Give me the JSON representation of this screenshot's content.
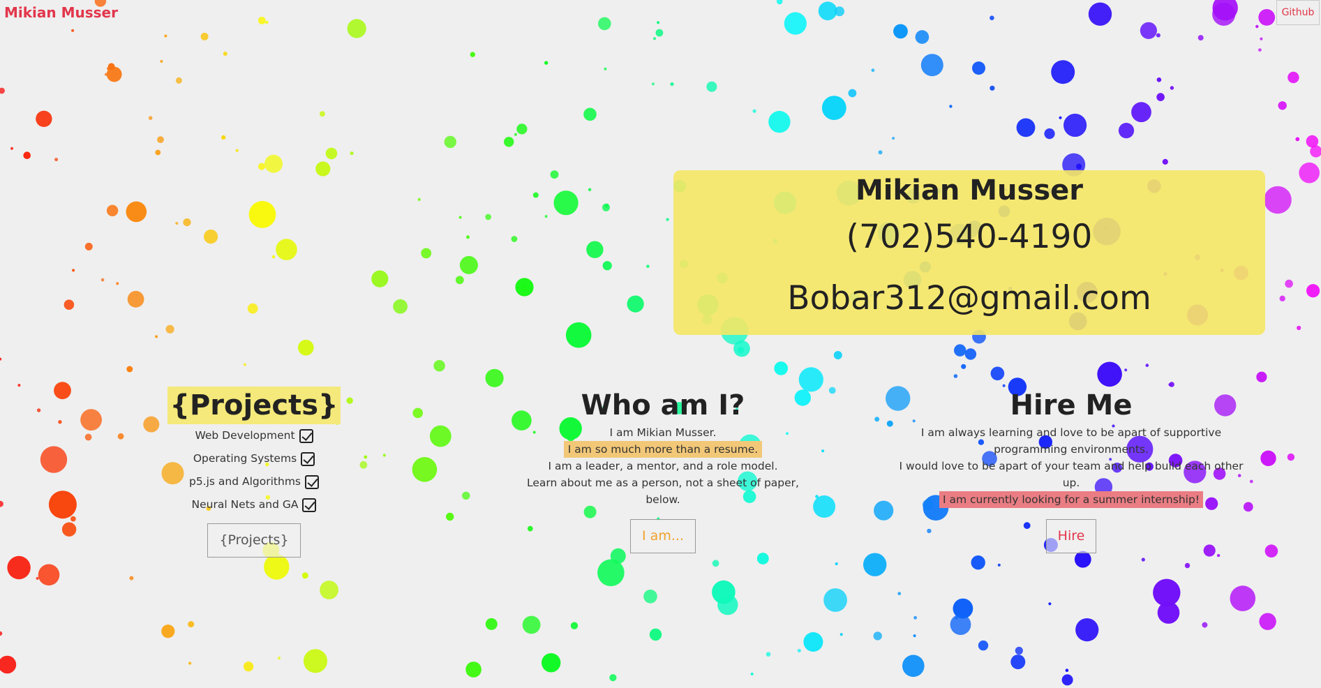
{
  "header": {
    "brand": "Mikian Musser",
    "github_label": "Github"
  },
  "contact": {
    "name": "Mikian Musser",
    "phone": "(702)540-4190",
    "email": "Bobar312@gmail.com"
  },
  "projects": {
    "title": "{Projects}",
    "items": [
      {
        "label": "Web Development",
        "checked": true
      },
      {
        "label": "Operating Systems",
        "checked": true
      },
      {
        "label": "p5.js and Algorithms",
        "checked": true
      },
      {
        "label": "Neural Nets and GA",
        "checked": true
      }
    ],
    "button_label": "{Projects}"
  },
  "who": {
    "title": "Who am I?",
    "lines": [
      "I am Mikian Musser.",
      "I am so much more than a resume.",
      "I am a leader, a mentor, and a role model.",
      "Learn about me as a person, not a sheet of paper, below."
    ],
    "button_label": "I am..."
  },
  "hire": {
    "title": "Hire Me",
    "lines": [
      "I am always learning and love to be apart of supportive programming environments.",
      "I would love to be apart of your team and help build each other up.",
      "I am currently looking for a summer internship!"
    ],
    "button_label": "Hire"
  },
  "colors": {
    "background": "#efefef",
    "brand": "#e2364a",
    "card": "#f5e764",
    "accent_orange": "#f0a12c"
  }
}
